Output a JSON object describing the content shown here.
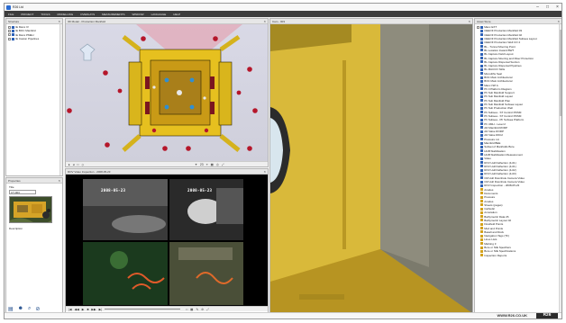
{
  "window": {
    "title": "R26 Ltd"
  },
  "menu": [
    "FILE",
    "PROJECT",
    "TOOLS",
    "MODELLING",
    "OVERLAYS",
    "MEASUREMENTS",
    "WINDOW",
    "LANGUAGE",
    "HELP"
  ],
  "structure": {
    "header": "Structure",
    "items": [
      "IE Manx IV",
      "IE BOC Manifold",
      "IE Manx PMEU",
      "IE Casion Pipelines"
    ]
  },
  "properties": {
    "header": "Properties",
    "title_label": "Title",
    "title_value": "CT-003",
    "description_label": "Description"
  },
  "view3d": {
    "header": "3D Model - Production Manifold",
    "toolbar": [
      "▸",
      "◂",
      "□",
      "◇",
      "✦",
      "⌖",
      "▦",
      "◎",
      "⤢"
    ],
    "zoom": "23"
  },
  "video": {
    "header": "ROV Video Inspection - 2008-05-23",
    "timestamps": [
      "2008-05-23",
      "2008-05-23",
      "",
      ""
    ],
    "controls": [
      "|◀",
      "◀◀",
      "▶",
      "■",
      "▶▶",
      "▶|"
    ],
    "tools": [
      "□",
      "▦",
      "✎",
      "⊘",
      "⤢"
    ]
  },
  "camera": {
    "header": "Cam - 003"
  },
  "asset": {
    "header": "Asset Store",
    "root": "Manx EXT",
    "items": [
      "CEEOF Production Manifold 03",
      "CEEOF Production Manifold 02",
      "CEEOF Production Manifold Subsea Layout",
      "CEEOF Production Well CO 2",
      "BL - Tunnel Mooring Point",
      "BL Location Inward BWT",
      "BL Capture Field Layout",
      "BL Capture Mooring and Riser Protection",
      "BL Capture Dispersal Suction",
      "BL Capture Dispersal Pipelines",
      "BL MACCO Stilts",
      "Monoliths Seal",
      "BOC Main Architectural",
      "BOC Main Architectural",
      "Manx ISP A",
      "Ph 0 Platform Diagram",
      "Ph Sub Manifold Support",
      "Ph Sub Manifold Layout",
      "Ph Sub Manifold Plan",
      "Ph Sub Manifold Subsea Layout",
      "Ph Sub Production Well",
      "Ph Subsea - ST Control PDSM",
      "Ph Subsea - ST Control PDSM",
      "Ph Subsea - Ph Subsea Platform",
      "Ph UMH - Level 2",
      "AD Manifold RORP",
      "AD Valve RORP",
      "AD Valve R0C2",
      "Pressure Lin",
      "Manifold BEE",
      "Subset of Manifolds Bore",
      "HGB Stabilisation",
      "HGB Stabilisation Measurement",
      "Video",
      "ROV Hull Deflection (4-01)",
      "ROV Hull Deflection (4-01)",
      "ROV Hull Deflection (4-02)",
      "ROV Hull Deflection (4-03)",
      "CM Hull Downhole Camera Video",
      "CM Hull Downhole Camera Video",
      "ROV Inspection - 2008-05-23",
      "Anodes",
      "Documents",
      "Pressure",
      "Anodes",
      "Sheets (pages)",
      "Cathodic",
      "Annotation",
      "Bathymetric Data 26",
      "Bathymetric Layout 02",
      "Flowfield Points",
      "Mud and Points",
      "Basalt and Rock",
      "Navigation Tags (TF)",
      "Lines Lists",
      "Marking 3",
      "Bore or NIE Specifiers",
      "Bore or NIE Specifications",
      "Inspection Reports"
    ]
  },
  "footer": {
    "url": "WWW.R26.CO.UK",
    "logo": "R26"
  }
}
